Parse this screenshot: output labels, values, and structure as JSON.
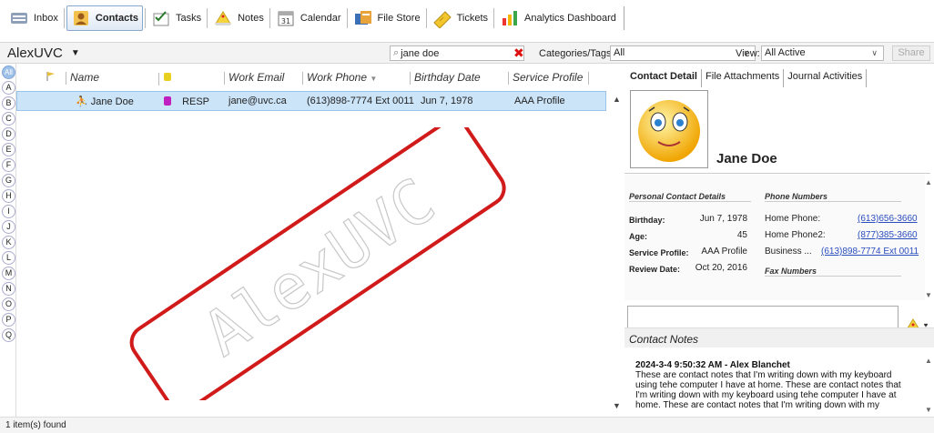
{
  "toolbar": {
    "items": [
      {
        "label": "Inbox",
        "icon": "inbox-icon",
        "active": false
      },
      {
        "label": "Contacts",
        "icon": "contacts-icon",
        "active": true
      },
      {
        "label": "Tasks",
        "icon": "tasks-icon",
        "active": false
      },
      {
        "label": "Notes",
        "icon": "notes-icon",
        "active": false
      },
      {
        "label": "Calendar",
        "icon": "calendar-icon",
        "active": false
      },
      {
        "label": "File Store",
        "icon": "file-store-icon",
        "active": false
      },
      {
        "label": "Tickets",
        "icon": "tickets-icon",
        "active": false
      },
      {
        "label": "Analytics Dashboard",
        "icon": "analytics-icon",
        "active": false
      }
    ]
  },
  "header": {
    "user": "AlexUVC",
    "search_value": "jane doe",
    "categories_label": "Categories/Tags:",
    "categories_value": "All",
    "view_label": "View:",
    "view_value": "All Active",
    "share_label": "Share"
  },
  "alphabet": [
    "All",
    "A",
    "B",
    "C",
    "D",
    "E",
    "F",
    "G",
    "H",
    "I",
    "J",
    "K",
    "L",
    "M",
    "N",
    "O",
    "P",
    "Q"
  ],
  "grid": {
    "columns": [
      "Name",
      "Work Email",
      "Work Phone",
      "Birthday Date",
      "Service Profile"
    ],
    "rows": [
      {
        "name": "Jane Doe",
        "tag": "RESP",
        "email": "jane@uvc.ca",
        "phone": "(613)898-7774 Ext 0011",
        "birthday": "Jun 7, 1978",
        "profile": "AAA Profile"
      }
    ]
  },
  "watermark_text": "AlexUVC",
  "right_panel": {
    "tabs": [
      "Contact Detail",
      "File Attachments",
      "Journal Activities"
    ],
    "contact_name": "Jane Doe",
    "personal": {
      "title": "Personal Contact Details",
      "rows": [
        {
          "label": "Birthday:",
          "value": "Jun 7, 1978"
        },
        {
          "label": "Age:",
          "value": "45"
        },
        {
          "label": "Service Profile:",
          "value": "AAA Profile"
        },
        {
          "label": "Review Date:",
          "value": "Oct 20, 2016"
        }
      ]
    },
    "phones": {
      "title": "Phone Numbers",
      "rows": [
        {
          "label": "Home Phone:",
          "value": "(613)656-3660"
        },
        {
          "label": "Home Phone2:",
          "value": "(877)385-3660"
        },
        {
          "label": "Business ...",
          "value": "(613)898-7774 Ext 0011"
        }
      ],
      "fax_title": "Fax Numbers"
    },
    "notes_header": "Contact Notes",
    "note_title": "2024-3-4 9:50:32 AM - Alex Blanchet",
    "note_body": "These are contact notes that I'm writing down with my keyboard using tehe computer I have at home. These are contact notes that I'm writing down with my keyboard using tehe computer I have at home. These are contact notes that I'm writing down with my"
  },
  "status": "1 item(s) found",
  "colors": {
    "selection": "#cce4f8",
    "link": "#2a4dbd",
    "watermark_border": "#d11a1a",
    "tag": "#c020c0"
  }
}
